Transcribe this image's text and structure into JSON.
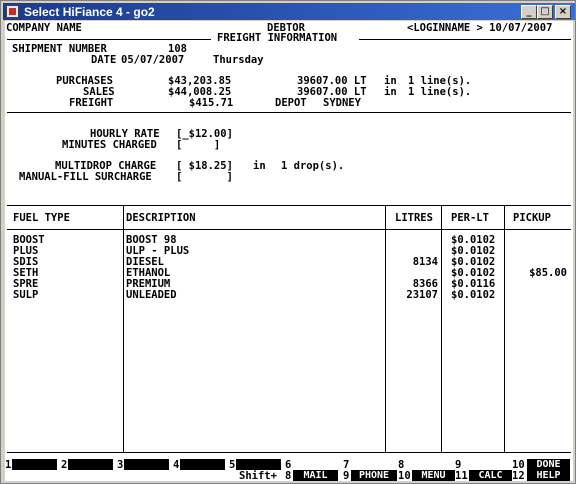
{
  "window": {
    "title": "Select HiFiance 4 - go2",
    "minimize": "_",
    "maximize": "□",
    "close": "×"
  },
  "header": {
    "company": "COMPANY NAME",
    "screen": "DEBTOR",
    "login_date": "<LOGINNAME > 10/07/2007"
  },
  "freight_info": {
    "section_title": "FREIGHT INFORMATION",
    "shipment_label": "SHIPMENT NUMBER",
    "shipment_value": "108",
    "date_label": "DATE",
    "date_value": "05/07/2007",
    "day_value": "Thursday",
    "purchases_label": "PURCHASES",
    "purchases_value": "$43,203.85",
    "purchases_qty": "39607.00 LT",
    "purchases_in": "in",
    "purchases_lines": "1 line(s).",
    "sales_label": "SALES",
    "sales_value": "$44,008.25",
    "sales_qty": "39607.00 LT",
    "sales_in": "in",
    "sales_lines": "1 line(s).",
    "freight_label": "FREIGHT",
    "freight_value": "$415.71",
    "depot_label": "DEPOT",
    "depot_value": "SYDNEY"
  },
  "charges": {
    "hourly_rate_label": "HOURLY RATE",
    "hourly_rate_value": "[_$12.00]",
    "minutes_label": "MINUTES CHARGED",
    "minutes_value": "[     ]",
    "multidrop_label": "MULTIDROP CHARGE",
    "multidrop_value": "[ $18.25]",
    "multidrop_in": "in",
    "multidrop_drops": "1 drop(s).",
    "manual_fill_label": "MANUAL-FILL SURCHARGE",
    "manual_fill_value": "[       ]"
  },
  "table": {
    "headers": {
      "fuel_type": "FUEL TYPE",
      "description": "DESCRIPTION",
      "litres": "LITRES",
      "per_lt": "PER-LT",
      "pickup": "PICKUP"
    },
    "rows": [
      {
        "fuel": "BOOST",
        "desc": "BOOST 98",
        "litres": "",
        "per_lt": "$0.0102",
        "pickup": ""
      },
      {
        "fuel": "PLUS",
        "desc": "ULP - PLUS",
        "litres": "",
        "per_lt": "$0.0102",
        "pickup": ""
      },
      {
        "fuel": "SDIS",
        "desc": "DIESEL",
        "litres": "8134",
        "per_lt": "$0.0102",
        "pickup": ""
      },
      {
        "fuel": "SETH",
        "desc": "ETHANOL",
        "litres": "",
        "per_lt": "$0.0102",
        "pickup": "$85.00"
      },
      {
        "fuel": "SPRE",
        "desc": "PREMIUM",
        "litres": "8366",
        "per_lt": "$0.0116",
        "pickup": ""
      },
      {
        "fuel": "SULP",
        "desc": "UNLEADED",
        "litres": "23107",
        "per_lt": "$0.0102",
        "pickup": ""
      }
    ]
  },
  "function_keys": {
    "k1": "1",
    "k2": "2",
    "k3": "3",
    "k4": "4",
    "k5": "5",
    "shift": "Shift+",
    "k6": "6",
    "k7": "7",
    "k8": "8",
    "k9": "9",
    "k10": "10",
    "k8b": "8",
    "k9b": "9",
    "k10b": "10",
    "k11": "11",
    "k12": "12",
    "mail": "MAIL",
    "phone": "PHONE",
    "menu": "MENU",
    "calc": "CALC",
    "done": "DONE",
    "help": "HELP"
  }
}
